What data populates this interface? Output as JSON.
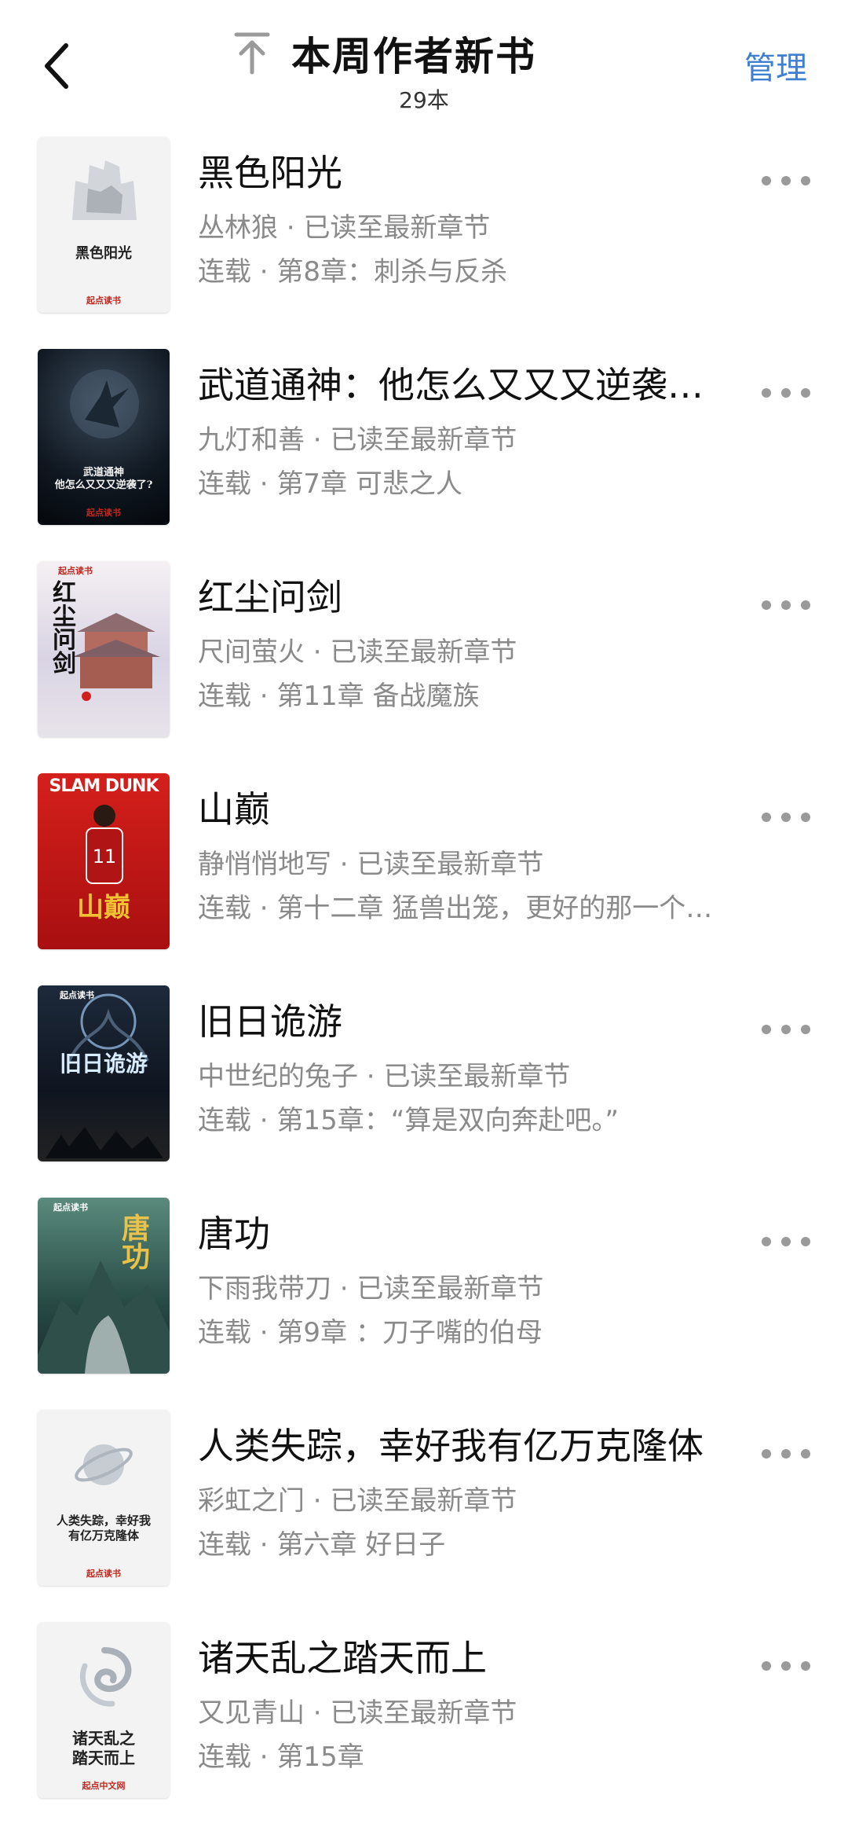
{
  "header": {
    "title": "本周作者新书",
    "count": "29本",
    "manage_label": "管理"
  },
  "books": [
    {
      "title": "黑色阳光",
      "author": "丛林狼",
      "progress": "已读至最新章节",
      "status": "连载",
      "chapter": "第8章：刺杀与反杀",
      "cover_text": "黑色阳光",
      "cover_style": "white",
      "cover_logo": "起点读书"
    },
    {
      "title": "武道通神：他怎么又又又逆袭…",
      "author": "九灯和善",
      "progress": "已读至最新章节",
      "status": "连载",
      "chapter": "第7章 可悲之人",
      "cover_text": "武道通神\n他怎么又又又逆袭了?",
      "cover_style": "dark",
      "cover_logo": "起点读书"
    },
    {
      "title": "红尘问剑",
      "author": "尺间萤火",
      "progress": "已读至最新章节",
      "status": "连载",
      "chapter": "第11章 备战魔族",
      "cover_text": "红尘问剑",
      "cover_style": "palace",
      "cover_logo": "起点读书"
    },
    {
      "title": "山巅",
      "author": "静悄悄地写",
      "progress": "已读至最新章节",
      "status": "连载",
      "chapter": "第十二章 猛兽出笼，更好的那一个…",
      "cover_text": "山巅",
      "cover_style": "red",
      "cover_logo": "SLAM DUNK"
    },
    {
      "title": "旧日诡游",
      "author": "中世纪的兔子",
      "progress": "已读至最新章节",
      "status": "连载",
      "chapter": "第15章：“算是双向奔赴吧。”",
      "cover_text": "旧日诡游",
      "cover_style": "night",
      "cover_logo": "起点读书"
    },
    {
      "title": "唐功",
      "author": "下雨我带刀",
      "progress": "已读至最新章节",
      "status": "连载",
      "chapter": "第9章 ：刀子嘴的伯母",
      "cover_text": "唐功",
      "cover_style": "mountain",
      "cover_logo": "起点读书"
    },
    {
      "title": "人类失踪，幸好我有亿万克隆体",
      "author": "彩虹之门",
      "progress": "已读至最新章节",
      "status": "连载",
      "chapter": "第六章 好日子",
      "cover_text": "人类失踪，幸好我\n有亿万克隆体",
      "cover_style": "white-planet",
      "cover_logo": "起点读书"
    },
    {
      "title": "诸天乱之踏天而上",
      "author": "又见青山",
      "progress": "已读至最新章节",
      "status": "连载",
      "chapter": "第15章",
      "cover_text": "诸天乱之\n踏天而上",
      "cover_style": "white-swirl",
      "cover_logo": "起点中文网"
    }
  ],
  "separator": " · ",
  "colors": {
    "accent": "#3d7fd0",
    "meta_text": "#8a8a8a",
    "title_text": "#111111"
  },
  "icons": {
    "back": "chevron-left-icon",
    "top": "arrow-up-to-top-icon",
    "more": "more-horizontal-icon"
  }
}
